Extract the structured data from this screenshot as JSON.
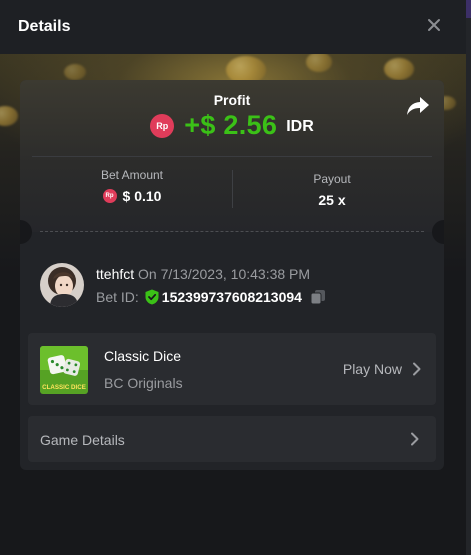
{
  "header": {
    "title": "Details",
    "close_icon": "close-icon"
  },
  "profit": {
    "label": "Profit",
    "currency_badge": "Rp",
    "amount": "+$ 2.56",
    "currency": "IDR",
    "share_icon": "share-icon"
  },
  "stats": {
    "bet_amount_label": "Bet Amount",
    "bet_amount_badge": "Rp",
    "bet_amount_value": "$ 0.10",
    "payout_label": "Payout",
    "payout_value": "25 x"
  },
  "bet": {
    "username": "ttehfct",
    "date_text": "On 7/13/2023, 10:43:38 PM",
    "bet_id_label": "Bet ID:",
    "bet_id_value": "152399737608213094",
    "verified_icon": "shield-check-icon",
    "copy_icon": "copy-icon"
  },
  "game": {
    "name": "Classic Dice",
    "provider": "BC Originals",
    "thumb_caption": "CLASSIC DICE",
    "play_label": "Play Now"
  },
  "game_details": {
    "label": "Game Details"
  },
  "colors": {
    "profit_green": "#3bc117",
    "badge_red": "#e03c5a",
    "panel": "#222428",
    "row_bg": "#2a2c30",
    "background": "#17181b"
  }
}
